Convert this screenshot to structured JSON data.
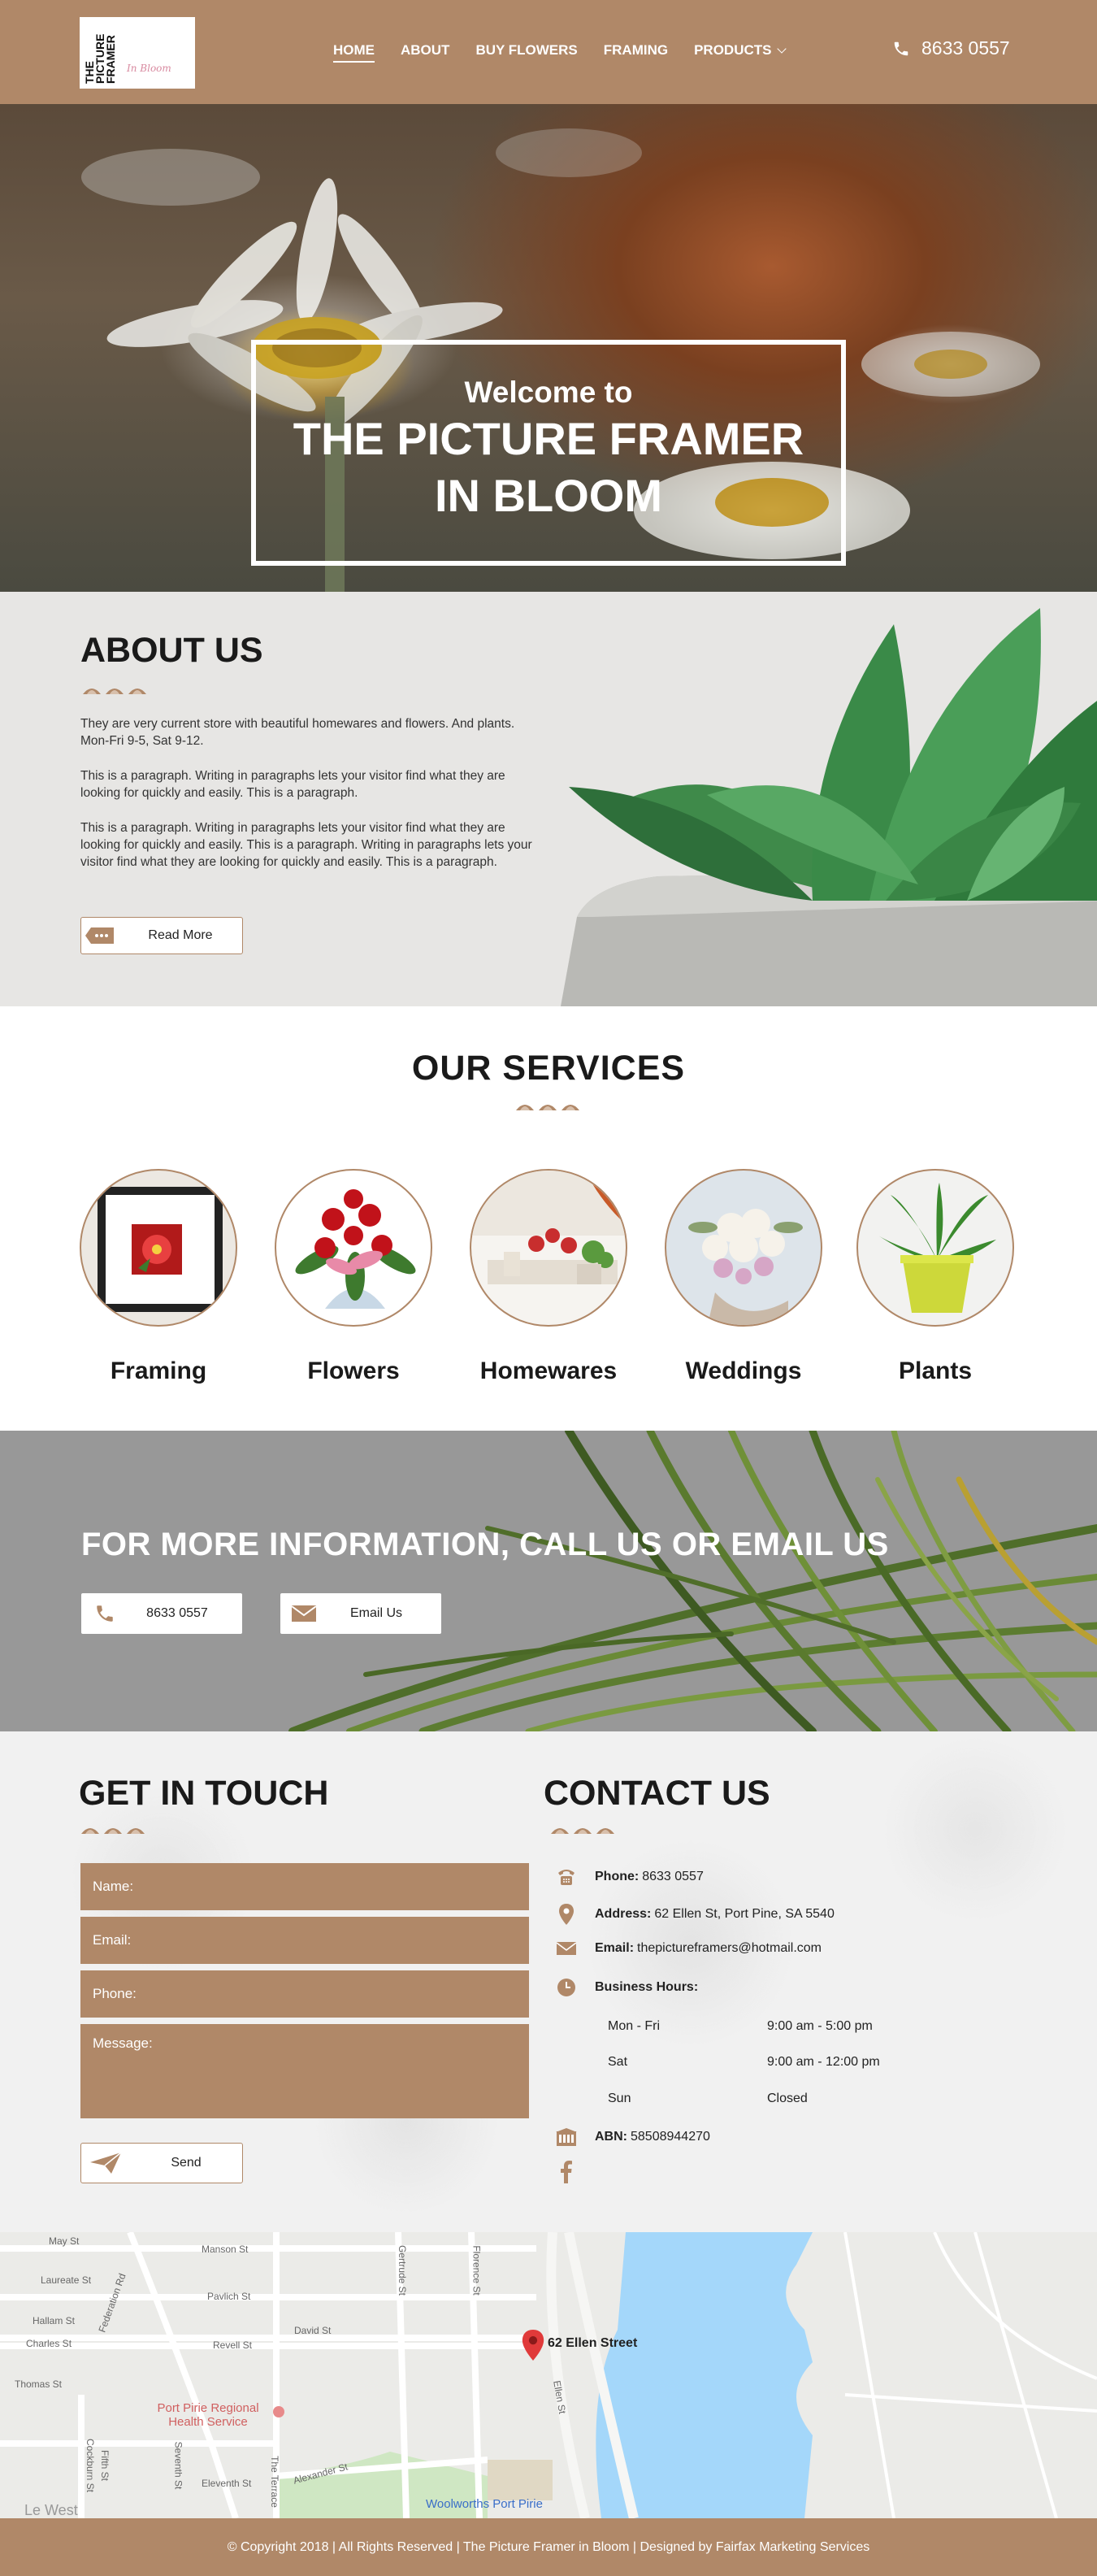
{
  "header": {
    "logo_text": "THE PICTURE FRAMER",
    "logo_script": "In Bloom",
    "nav": [
      {
        "label": "HOME",
        "active": true
      },
      {
        "label": "ABOUT",
        "active": false
      },
      {
        "label": "BUY FLOWERS",
        "active": false
      },
      {
        "label": "FRAMING",
        "active": false
      },
      {
        "label": "PRODUCTS",
        "active": false,
        "dropdown": true
      }
    ],
    "phone": "8633 0557",
    "phone_icon": "phone-icon"
  },
  "hero": {
    "welcome": "Welcome to",
    "title_line1": "THE PICTURE FRAMER",
    "title_line2": "IN BLOOM"
  },
  "about": {
    "heading": "ABOUT US",
    "paragraphs": [
      "They are very current store with beautiful homewares and flowers. And plants. Mon-Fri 9-5, Sat 9-12.",
      "This is a paragraph. Writing in paragraphs lets your visitor find what they are looking for quickly and easily. This is a paragraph.",
      "This is a paragraph. Writing in paragraphs lets your visitor find what they are looking for quickly and easily. This is a paragraph. Writing in paragraphs lets your visitor find what they are looking for quickly and easily. This is a paragraph."
    ],
    "read_more": "Read More"
  },
  "services": {
    "heading": "OUR  SERVICES",
    "items": [
      {
        "label": "Framing"
      },
      {
        "label": "Flowers"
      },
      {
        "label": "Homewares"
      },
      {
        "label": "Weddings"
      },
      {
        "label": "Plants"
      }
    ]
  },
  "cta": {
    "heading": "FOR MORE INFORMATION, CALL US OR EMAIL US",
    "phone_button": "8633 0557",
    "email_button": "Email Us"
  },
  "get_in_touch": {
    "heading": "GET IN TOUCH",
    "fields": {
      "name": "Name:",
      "email": "Email:",
      "phone": "Phone:",
      "message": "Message:"
    },
    "send": "Send"
  },
  "contact_us": {
    "heading": "CONTACT US",
    "phone_label": "Phone:",
    "phone": "8633 0557",
    "address_label": "Address:",
    "address": "62 Ellen St, Port Pine, SA 5540",
    "email_label": "Email:",
    "email": "thepictureframers@hotmail.com",
    "hours_label": "Business Hours:",
    "hours": [
      {
        "day": "Mon - Fri",
        "time": "9:00 am - 5:00 pm"
      },
      {
        "day": "Sat",
        "time": "9:00 am - 12:00 pm"
      },
      {
        "day": "Sun",
        "time": "Closed"
      }
    ],
    "abn_label": "ABN:",
    "abn": "58508944270"
  },
  "map": {
    "pin_label": "62 Ellen Street",
    "streets": [
      "May St",
      "Manson St",
      "Laureate St",
      "Pavlich St",
      "Hallam St",
      "Charles St",
      "Revell St",
      "David St",
      "Thomas St",
      "Eleventh St",
      "Alexander St",
      "Ellen St",
      "Gertrude St",
      "Florence St",
      "Federation Rd",
      "Cockburn St",
      "Fifth St",
      "Seventh St",
      "The Terrace",
      "Le West"
    ],
    "places": [
      "Port Pirie Regional Health Service",
      "Woolworths Port Pirie"
    ]
  },
  "footer": {
    "text": "© Copyright 2018 | All Rights Reserved | The Picture Framer in Bloom | Designed by Fairfax Marketing Services"
  },
  "colors": {
    "brand": "#b08868",
    "white": "#ffffff",
    "dark": "#1a1a1a"
  }
}
